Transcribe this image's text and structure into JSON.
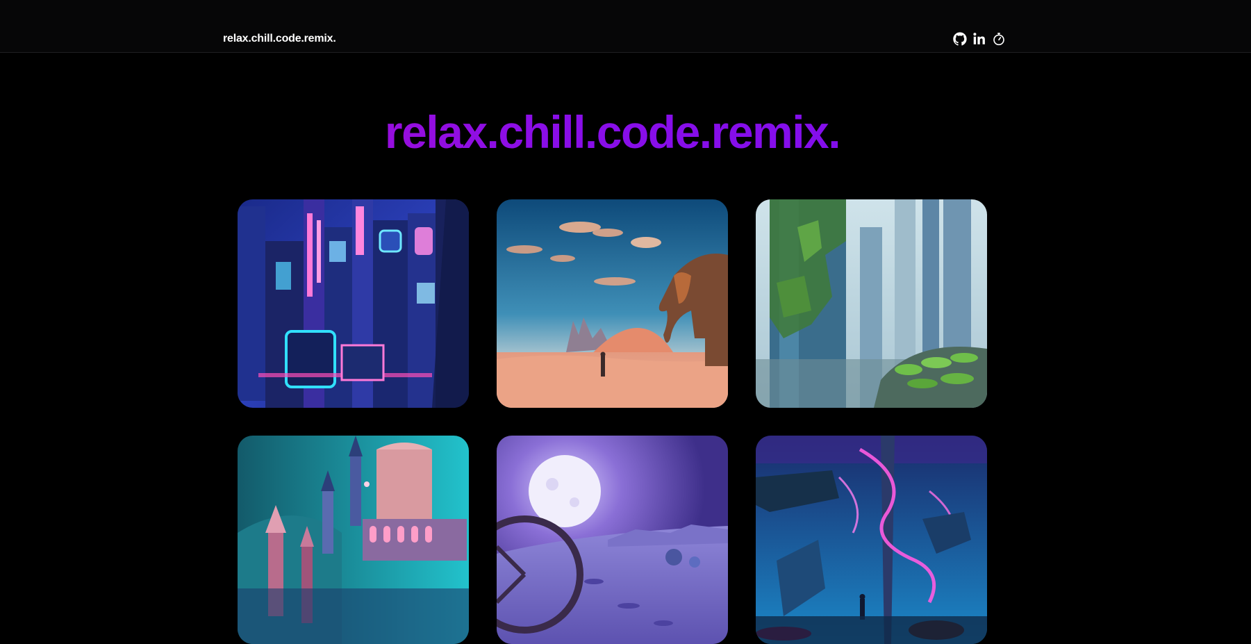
{
  "nav": {
    "brand": "relax.chill.code.remix.",
    "social": [
      {
        "icon": "github-icon"
      },
      {
        "icon": "linkedin-icon"
      },
      {
        "icon": "stopwatch-icon"
      }
    ]
  },
  "hero": {
    "title": "relax.chill.code.remix."
  },
  "gallery": {
    "items": [
      {
        "icon": "neon-city-image"
      },
      {
        "icon": "desert-elephant-image"
      },
      {
        "icon": "overgrown-towers-image"
      },
      {
        "icon": "fantasy-castle-image"
      },
      {
        "icon": "moon-landscape-image"
      },
      {
        "icon": "neon-alien-world-image"
      }
    ]
  },
  "colors": {
    "background": "#000000",
    "title_gradient_start": "#b40fc6",
    "title_gradient_end": "#7a0ff0"
  }
}
